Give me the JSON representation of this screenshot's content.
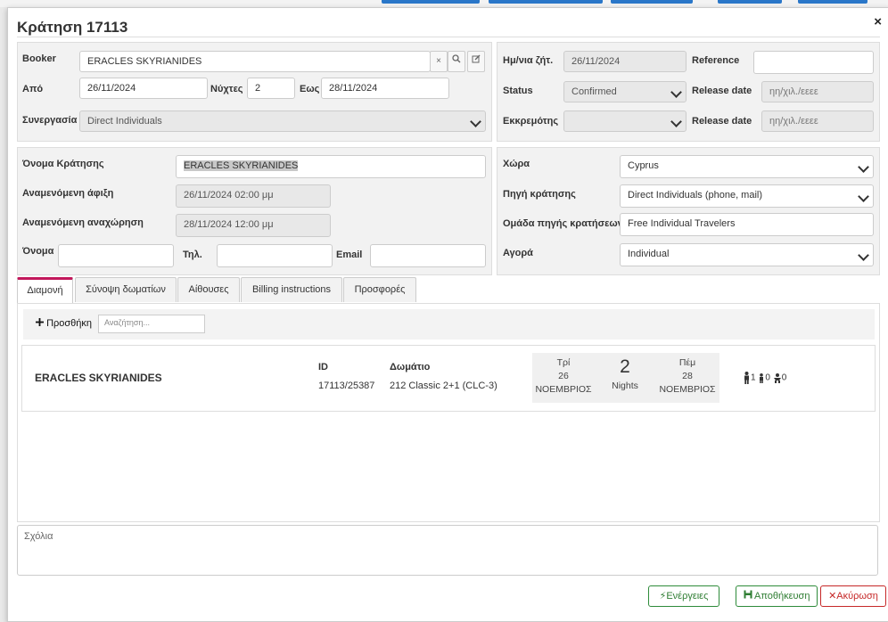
{
  "modal": {
    "title": "Κράτηση 17113",
    "close": "×"
  },
  "booker": {
    "label": "Booker",
    "value": "ERACLES SKYRIANIDES",
    "clear_icon": "×",
    "search_icon": "⌕",
    "edit_icon": "✎"
  },
  "dates": {
    "from_label": "Από",
    "from": "26/11/2024",
    "nights_label": "Νύχτες",
    "nights": "2",
    "to_label": "Εως",
    "to": "28/11/2024"
  },
  "partnership": {
    "label": "Συνεργασία",
    "value": "Direct Individuals"
  },
  "request": {
    "date_label": "Ημ/νια ζήτ.",
    "date": "26/11/2024",
    "reference_label": "Reference",
    "reference": "",
    "status_label": "Status",
    "status": "Confirmed",
    "release1_label": "Release date",
    "release1_placeholder": "ηη/χιλ./εεεε",
    "pending_label": "Εκκρεμότης",
    "pending": "",
    "release2_label": "Release date",
    "release2_placeholder": "ηη/χιλ./εεεε"
  },
  "guest": {
    "booking_name_label": "Όνομα Κράτησης",
    "booking_name": "ERACLES SKYRIANIDES",
    "arrival_label": "Αναμενόμενη άφιξη",
    "arrival": "26/11/2024 02:00 μμ",
    "departure_label": "Αναμενόμενη αναχώρηση",
    "departure": "28/11/2024 12:00 μμ",
    "name_label": "Όνομα",
    "name": "",
    "phone_label": "Τηλ.",
    "phone": "",
    "email_label": "Email",
    "email": ""
  },
  "source": {
    "country_label": "Χώρα",
    "country": "Cyprus",
    "source_label": "Πηγή κράτησης",
    "source": "Direct Individuals (phone, mail)",
    "group_label": "Ομάδα πηγής κρατήσεων",
    "group": "Free Individual Travelers",
    "market_label": "Αγορά",
    "market": "Individual"
  },
  "tabs": [
    {
      "label": "Διαμονή"
    },
    {
      "label": "Σύνοψη δωματίων"
    },
    {
      "label": "Αίθουσες"
    },
    {
      "label": "Billing instructions"
    },
    {
      "label": "Προσφορές"
    }
  ],
  "stay": {
    "add_label": "Προσθήκη",
    "search_placeholder": "Αναζήτηση...",
    "guest_name": "ERACLES SKYRIANIDES",
    "id_label": "ID",
    "id": "17113/25387",
    "room_label": "Δωμάτιο",
    "room": "212 Classic 2+1 (CLC-3)",
    "arrival": {
      "weekday": "Τρί",
      "day": "26",
      "month": "ΝΟΕΜΒΡΙΟΣ"
    },
    "nights": {
      "count": "2",
      "label": "Nights"
    },
    "departure": {
      "weekday": "Πέμ",
      "day": "28",
      "month": "ΝΟΕΜΒΡΙΟΣ"
    },
    "adults": "1",
    "children": "0",
    "infants": "0"
  },
  "comments": {
    "placeholder": "Σχόλια"
  },
  "footer": {
    "actions": "Ενέργειες",
    "save": "Αποθήκευση",
    "cancel": "Ακύρωση"
  },
  "colors": {
    "accent_tab": "#c2185b",
    "green": "#2e7d32",
    "red": "#c62828",
    "panel": "#f2f2f2"
  }
}
